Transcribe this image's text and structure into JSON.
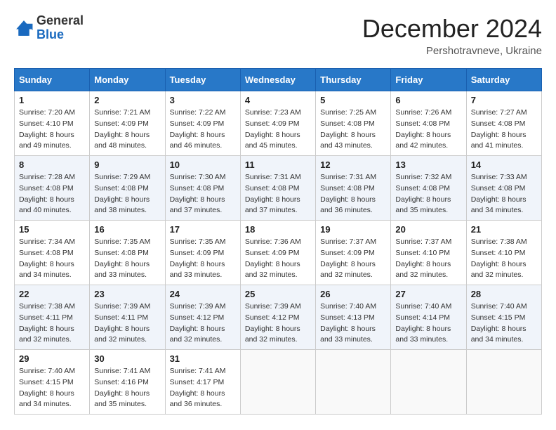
{
  "header": {
    "logo": {
      "line1": "General",
      "line2": "Blue"
    },
    "title": "December 2024",
    "location": "Pershotravneve, Ukraine"
  },
  "weekdays": [
    "Sunday",
    "Monday",
    "Tuesday",
    "Wednesday",
    "Thursday",
    "Friday",
    "Saturday"
  ],
  "weeks": [
    [
      {
        "day": "1",
        "sunrise": "7:20 AM",
        "sunset": "4:10 PM",
        "daylight": "8 hours and 49 minutes."
      },
      {
        "day": "2",
        "sunrise": "7:21 AM",
        "sunset": "4:09 PM",
        "daylight": "8 hours and 48 minutes."
      },
      {
        "day": "3",
        "sunrise": "7:22 AM",
        "sunset": "4:09 PM",
        "daylight": "8 hours and 46 minutes."
      },
      {
        "day": "4",
        "sunrise": "7:23 AM",
        "sunset": "4:09 PM",
        "daylight": "8 hours and 45 minutes."
      },
      {
        "day": "5",
        "sunrise": "7:25 AM",
        "sunset": "4:08 PM",
        "daylight": "8 hours and 43 minutes."
      },
      {
        "day": "6",
        "sunrise": "7:26 AM",
        "sunset": "4:08 PM",
        "daylight": "8 hours and 42 minutes."
      },
      {
        "day": "7",
        "sunrise": "7:27 AM",
        "sunset": "4:08 PM",
        "daylight": "8 hours and 41 minutes."
      }
    ],
    [
      {
        "day": "8",
        "sunrise": "7:28 AM",
        "sunset": "4:08 PM",
        "daylight": "8 hours and 40 minutes."
      },
      {
        "day": "9",
        "sunrise": "7:29 AM",
        "sunset": "4:08 PM",
        "daylight": "8 hours and 38 minutes."
      },
      {
        "day": "10",
        "sunrise": "7:30 AM",
        "sunset": "4:08 PM",
        "daylight": "8 hours and 37 minutes."
      },
      {
        "day": "11",
        "sunrise": "7:31 AM",
        "sunset": "4:08 PM",
        "daylight": "8 hours and 37 minutes."
      },
      {
        "day": "12",
        "sunrise": "7:31 AM",
        "sunset": "4:08 PM",
        "daylight": "8 hours and 36 minutes."
      },
      {
        "day": "13",
        "sunrise": "7:32 AM",
        "sunset": "4:08 PM",
        "daylight": "8 hours and 35 minutes."
      },
      {
        "day": "14",
        "sunrise": "7:33 AM",
        "sunset": "4:08 PM",
        "daylight": "8 hours and 34 minutes."
      }
    ],
    [
      {
        "day": "15",
        "sunrise": "7:34 AM",
        "sunset": "4:08 PM",
        "daylight": "8 hours and 34 minutes."
      },
      {
        "day": "16",
        "sunrise": "7:35 AM",
        "sunset": "4:08 PM",
        "daylight": "8 hours and 33 minutes."
      },
      {
        "day": "17",
        "sunrise": "7:35 AM",
        "sunset": "4:09 PM",
        "daylight": "8 hours and 33 minutes."
      },
      {
        "day": "18",
        "sunrise": "7:36 AM",
        "sunset": "4:09 PM",
        "daylight": "8 hours and 32 minutes."
      },
      {
        "day": "19",
        "sunrise": "7:37 AM",
        "sunset": "4:09 PM",
        "daylight": "8 hours and 32 minutes."
      },
      {
        "day": "20",
        "sunrise": "7:37 AM",
        "sunset": "4:10 PM",
        "daylight": "8 hours and 32 minutes."
      },
      {
        "day": "21",
        "sunrise": "7:38 AM",
        "sunset": "4:10 PM",
        "daylight": "8 hours and 32 minutes."
      }
    ],
    [
      {
        "day": "22",
        "sunrise": "7:38 AM",
        "sunset": "4:11 PM",
        "daylight": "8 hours and 32 minutes."
      },
      {
        "day": "23",
        "sunrise": "7:39 AM",
        "sunset": "4:11 PM",
        "daylight": "8 hours and 32 minutes."
      },
      {
        "day": "24",
        "sunrise": "7:39 AM",
        "sunset": "4:12 PM",
        "daylight": "8 hours and 32 minutes."
      },
      {
        "day": "25",
        "sunrise": "7:39 AM",
        "sunset": "4:12 PM",
        "daylight": "8 hours and 32 minutes."
      },
      {
        "day": "26",
        "sunrise": "7:40 AM",
        "sunset": "4:13 PM",
        "daylight": "8 hours and 33 minutes."
      },
      {
        "day": "27",
        "sunrise": "7:40 AM",
        "sunset": "4:14 PM",
        "daylight": "8 hours and 33 minutes."
      },
      {
        "day": "28",
        "sunrise": "7:40 AM",
        "sunset": "4:15 PM",
        "daylight": "8 hours and 34 minutes."
      }
    ],
    [
      {
        "day": "29",
        "sunrise": "7:40 AM",
        "sunset": "4:15 PM",
        "daylight": "8 hours and 34 minutes."
      },
      {
        "day": "30",
        "sunrise": "7:41 AM",
        "sunset": "4:16 PM",
        "daylight": "8 hours and 35 minutes."
      },
      {
        "day": "31",
        "sunrise": "7:41 AM",
        "sunset": "4:17 PM",
        "daylight": "8 hours and 36 minutes."
      },
      null,
      null,
      null,
      null
    ]
  ]
}
